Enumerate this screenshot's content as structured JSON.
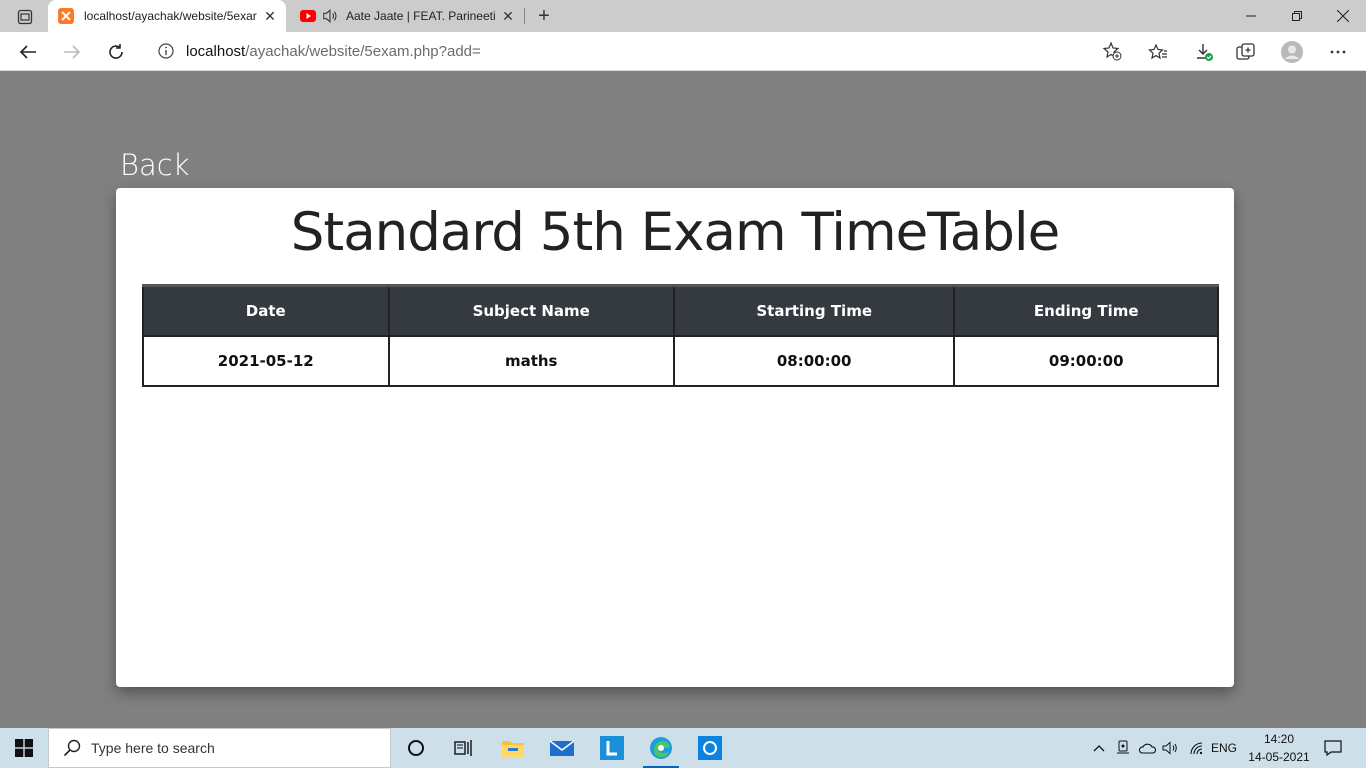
{
  "browser": {
    "tabs": [
      {
        "title": "localhost/ayachak/website/5exar",
        "active": true
      },
      {
        "title": "Aate Jaate | FEAT. Parineeti C",
        "active": false
      }
    ],
    "address": {
      "host": "localhost",
      "path": "/ayachak/website/5exam.php?add="
    }
  },
  "page": {
    "back_label": "Back",
    "title": "Standard 5th Exam TimeTable",
    "table": {
      "headers": [
        "Date",
        "Subject Name",
        "Starting Time",
        "Ending Time"
      ],
      "rows": [
        [
          "2021-05-12",
          "maths",
          "08:00:00",
          "09:00:00"
        ]
      ]
    }
  },
  "taskbar": {
    "search_placeholder": "Type here to search",
    "language": "ENG",
    "time": "14:20",
    "date": "14-05-2021"
  }
}
